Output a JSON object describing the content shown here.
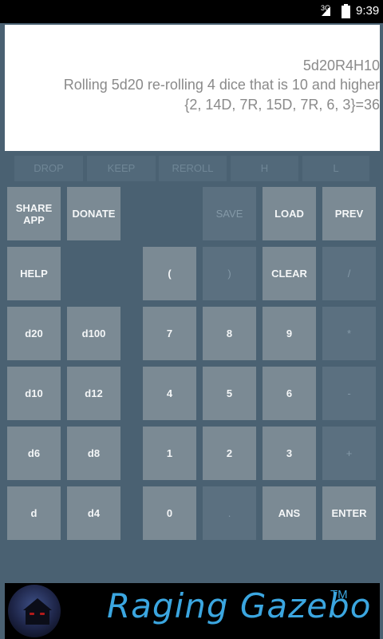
{
  "status_bar": {
    "network": "3G",
    "time": "9:39"
  },
  "display": {
    "expression": "5d20R4H10",
    "description": "Rolling 5d20 re-rolling 4 dice that is 10 and higher",
    "result": "{2, 14D, 7R, 15D, 7R, 6, 3}=36"
  },
  "modifiers": [
    "DROP",
    "KEEP",
    "REROLL",
    "H",
    "L"
  ],
  "buttons": {
    "share_app": "SHARE\nAPP",
    "donate": "DONATE",
    "save": "SAVE",
    "load": "LOAD",
    "prev": "PREV",
    "help": "HELP",
    "open_paren": "(",
    "close_paren": ")",
    "clear": "CLEAR",
    "divide": "/",
    "d20": "d20",
    "d100": "d100",
    "n7": "7",
    "n8": "8",
    "n9": "9",
    "multiply": "*",
    "d10": "d10",
    "d12": "d12",
    "n4": "4",
    "n5": "5",
    "n6": "6",
    "minus": "-",
    "d6": "d6",
    "d8": "d8",
    "n1": "1",
    "n2": "2",
    "n3": "3",
    "plus": "+",
    "d": "d",
    "d4": "d4",
    "n0": "0",
    "dot": ".",
    "ans": "ANS",
    "enter": "ENTER"
  },
  "ad": {
    "brand": "Raging Gazebo",
    "tm": "TM"
  }
}
